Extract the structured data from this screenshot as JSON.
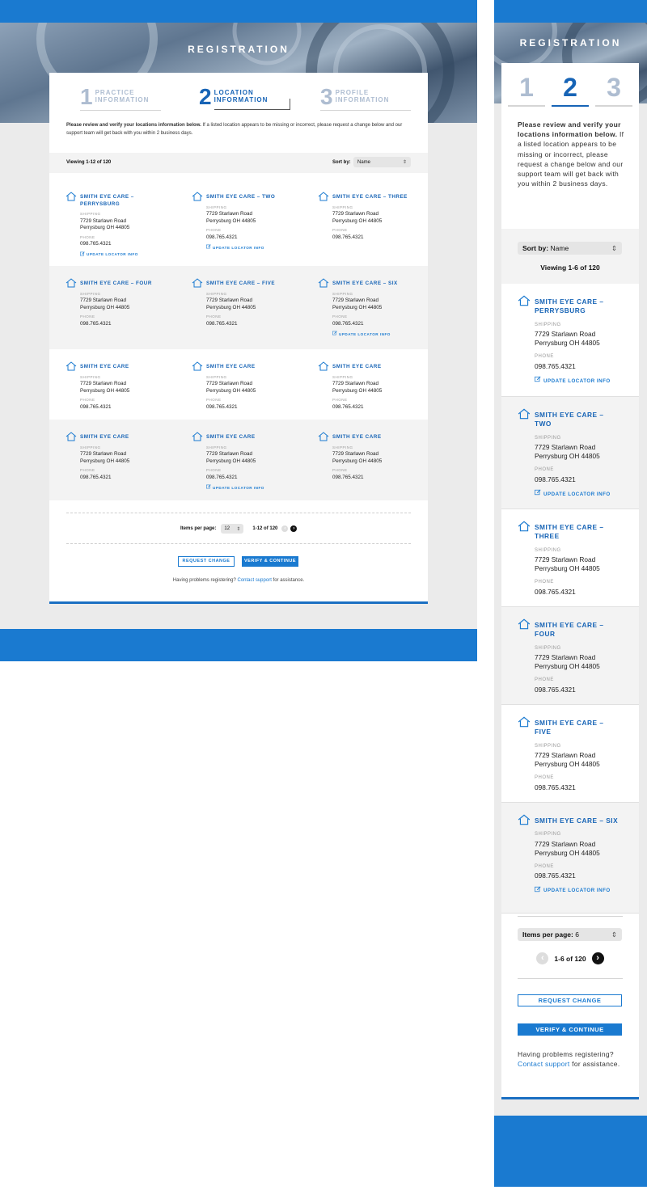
{
  "desktop": {
    "header_title": "REGISTRATION",
    "steps": [
      {
        "num": "1",
        "line1": "PRACTICE",
        "line2": "INFORMATION",
        "active": false
      },
      {
        "num": "2",
        "line1": "LOCATION",
        "line2": "INFORMATION",
        "active": true
      },
      {
        "num": "3",
        "line1": "PROFILE",
        "line2": "INFORMATION",
        "active": false
      }
    ],
    "intro_bold": "Please review and verify your locations information below.",
    "intro_rest": " If a listed location appears to be missing or incorrect, please request a change below and our support team will get back with you within 2 business days.",
    "viewing": "Viewing 1-12 of 120",
    "sort_label": "Sort by:",
    "sort_value": "Name",
    "rows": [
      [
        {
          "name1": "SMITH EYE CARE –",
          "name2": "PERRYSBURG",
          "update": true
        },
        {
          "name1": "SMITH EYE CARE – TWO",
          "name2": "",
          "update": true
        },
        {
          "name1": "SMITH EYE CARE – THREE",
          "name2": "",
          "update": false
        }
      ],
      [
        {
          "name1": "SMITH EYE CARE – FOUR",
          "name2": "",
          "update": false
        },
        {
          "name1": "SMITH EYE CARE – FIVE",
          "name2": "",
          "update": false
        },
        {
          "name1": "SMITH EYE CARE – SIX",
          "name2": "",
          "update": true
        }
      ],
      [
        {
          "name1": "SMITH EYE CARE",
          "name2": "",
          "update": false
        },
        {
          "name1": "SMITH EYE CARE",
          "name2": "",
          "update": false
        },
        {
          "name1": "SMITH EYE CARE",
          "name2": "",
          "update": false
        }
      ],
      [
        {
          "name1": "SMITH EYE CARE",
          "name2": "",
          "update": false
        },
        {
          "name1": "SMITH EYE CARE",
          "name2": "",
          "update": true
        },
        {
          "name1": "SMITH EYE CARE",
          "name2": "",
          "update": false
        }
      ]
    ],
    "shipping_label": "SHIPPING",
    "address1": "7729 Starlawn Road",
    "address2": "Perrysburg OH 44805",
    "phone_label": "PHONE",
    "phone": "098.765.4321",
    "update_label": "UPDATE LOCATOR INFO",
    "items_per_page_label": "Items per page:",
    "items_per_page_value": "12",
    "range": "1-12 of 120",
    "request_change": "REQUEST CHANGE",
    "verify_continue": "VERIFY & CONTINUE",
    "help_pre": "Having problems registering? ",
    "help_link": "Contact support",
    "help_post": " for assistance."
  },
  "mobile": {
    "header_title": "REGISTRATION",
    "steps": [
      "1",
      "2",
      "3"
    ],
    "intro_bold": "Please review and verify your locations information below.",
    "intro_rest": " If a listed location appears to be missing or incorrect, please request a change below and our support team will get back with you within 2 business days.",
    "sort_label": "Sort by:",
    "sort_value": "Name",
    "viewing": "Viewing 1-6 of 120",
    "locations": [
      {
        "name1": "SMITH EYE CARE –",
        "name2": "PERRYSBURG",
        "update": true
      },
      {
        "name1": "SMITH EYE CARE –",
        "name2": "TWO",
        "update": true
      },
      {
        "name1": "SMITH EYE CARE –",
        "name2": "THREE",
        "update": false
      },
      {
        "name1": "SMITH EYE CARE –",
        "name2": "FOUR",
        "update": false
      },
      {
        "name1": "SMITH EYE CARE –",
        "name2": "FIVE",
        "update": false
      },
      {
        "name1": "SMITH EYE CARE – SIX",
        "name2": "",
        "update": true
      }
    ],
    "items_per_page_label": "Items per page:",
    "items_per_page_value": "6",
    "range": "1-6 of 120",
    "request_change": "REQUEST CHANGE",
    "verify_continue": "VERIFY & CONTINUE",
    "help_pre": "Having problems registering? ",
    "help_link": "Contact support",
    "help_post": " for assistance."
  }
}
